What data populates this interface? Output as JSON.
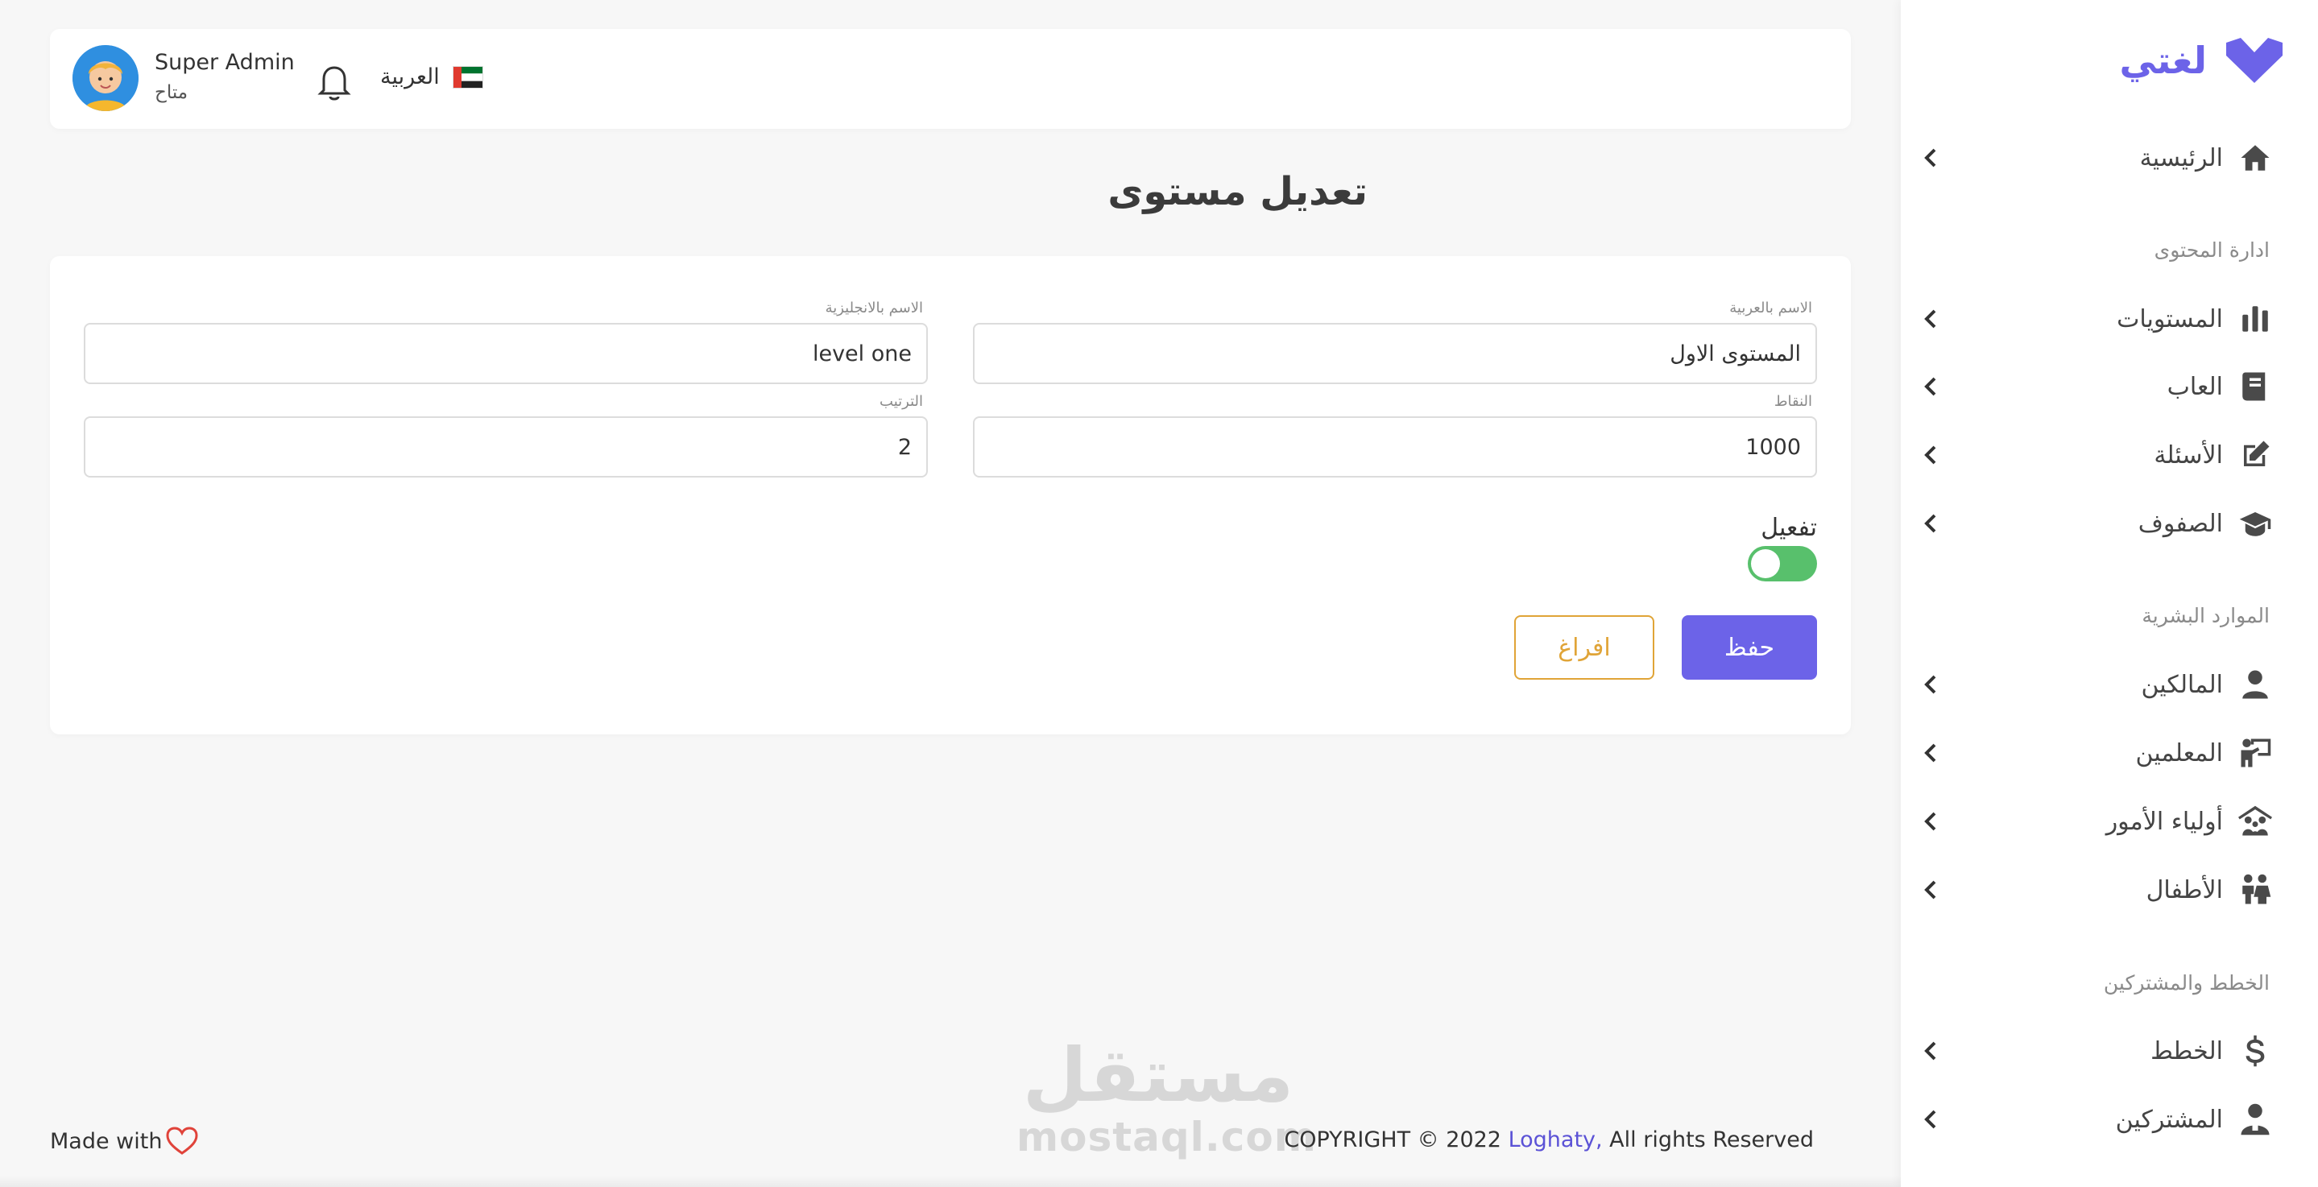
{
  "brand": {
    "name": "لغتي",
    "color": "#6c63e8"
  },
  "topbar": {
    "user_name": "Super Admin",
    "user_status": "متاح",
    "language": "العربية"
  },
  "page": {
    "title": "تعديل مستوى"
  },
  "form": {
    "name_ar": {
      "label": "الاسم بالعربية",
      "value": "المستوى الاول"
    },
    "name_en": {
      "label": "الاسم بالانجليزية",
      "value": "level one"
    },
    "points": {
      "label": "النقاط",
      "value": "1000"
    },
    "order": {
      "label": "الترتيب",
      "value": "2"
    },
    "active": {
      "label": "تفعيل",
      "enabled": true
    },
    "save_label": "حفظ",
    "clear_label": "افراغ"
  },
  "sidebar": {
    "home": {
      "label": "الرئيسية",
      "icon": "home-icon"
    },
    "section_content": "ادارة المحتوى",
    "levels": {
      "label": "المستويات",
      "icon": "bar-chart-icon"
    },
    "games": {
      "label": "العاب",
      "icon": "book-icon"
    },
    "questions": {
      "label": "الأسئلة",
      "icon": "edit-icon"
    },
    "classes": {
      "label": "الصفوف",
      "icon": "graduation-cap-icon"
    },
    "section_hr": "الموارد البشرية",
    "owners": {
      "label": "المالكين",
      "icon": "user-icon"
    },
    "teachers": {
      "label": "المعلمين",
      "icon": "teacher-icon"
    },
    "parents": {
      "label": "أولياء الأمور",
      "icon": "family-icon"
    },
    "children": {
      "label": "الأطفال",
      "icon": "children-icon"
    },
    "section_plans": "الخطط والمشتركين",
    "plans": {
      "label": "الخطط",
      "icon": "dollar-icon"
    },
    "subscribers": {
      "label": "المشتركين",
      "icon": "subscriber-icon"
    }
  },
  "footer": {
    "made_with": "Made with",
    "copyright_prefix": "COPYRIGHT © 2022 ",
    "company": "Loghaty,",
    "rights": " All rights Reserved"
  },
  "watermark": {
    "arabic": "مستقل",
    "latin": "mostaql.com"
  }
}
